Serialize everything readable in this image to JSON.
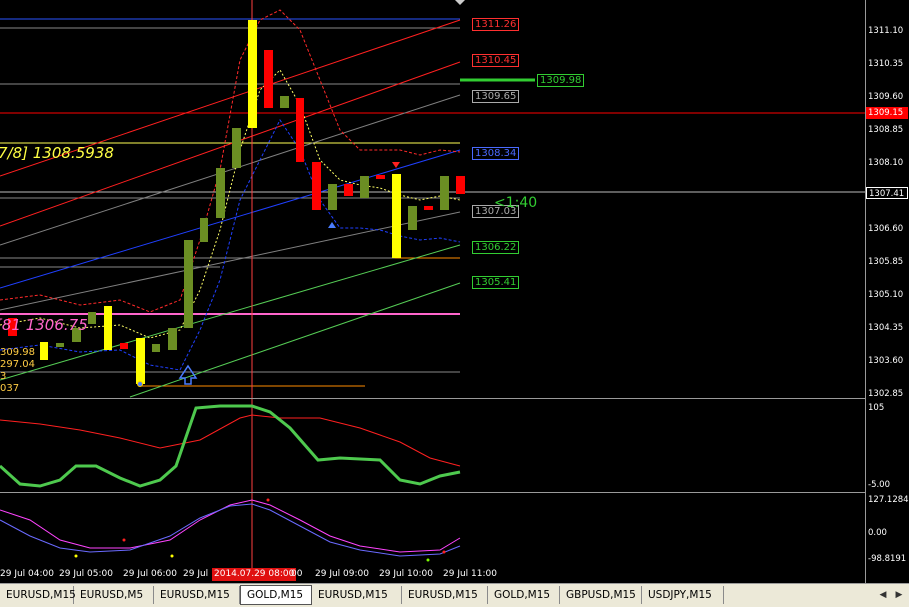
{
  "window": {
    "symbol": "GOLD",
    "timeframe": "M15"
  },
  "price_axis": {
    "labels": [
      "1311.10",
      "1310.35",
      "1309.60",
      "1308.85",
      "1308.10",
      "1307.35",
      "1306.60",
      "1305.85",
      "1305.10",
      "1304.35",
      "1303.60",
      "1302.85"
    ],
    "current_price": "1307.41",
    "highlight_price": "1309.15"
  },
  "price_tags": {
    "tag1": "1311.26",
    "tag2": "1310.45",
    "tag3": "1309.98",
    "tag4": "1309.65",
    "tag5": "1308.34",
    "tag6": "1307.03",
    "tag7": "1306.22",
    "tag8": "1305.41"
  },
  "overlays": {
    "murrey_label": "7/8]  1308.5938",
    "lower_label": "[81  1306.75",
    "countdown": "<1:40",
    "left_values": [
      "309.98",
      "297.04",
      "3",
      "037"
    ]
  },
  "indicator1": {
    "top_label": "105",
    "bottom_label": "-5.00"
  },
  "indicator2": {
    "top_label": "127.1284",
    "mid_label": "0.00",
    "bottom_label": "-98.8191"
  },
  "time_axis": {
    "labels": [
      "29 Jul 04:00",
      "29 Jul 05:00",
      "29 Jul 06:00",
      "29 Jul",
      "00",
      "29 Jul 09:00",
      "29 Jul 10:00",
      "29 Jul 11:00"
    ],
    "crosshair_time": "2014.07.29 08:00"
  },
  "tabs": [
    {
      "label": "EURUSD,M15",
      "active": false
    },
    {
      "label": "EURUSD,M5",
      "active": false
    },
    {
      "label": "EURUSD,M15",
      "active": false
    },
    {
      "label": "GOLD,M15",
      "active": true
    },
    {
      "label": "EURUSD,M15",
      "active": false
    },
    {
      "label": "EURUSD,M15",
      "active": false
    },
    {
      "label": "GOLD,M15",
      "active": false
    },
    {
      "label": "GBPUSD,M15",
      "active": false
    },
    {
      "label": "USDJPY,M15",
      "active": false
    }
  ],
  "colors": {
    "bull": "#6b8e23",
    "bear": "#ff0000",
    "highlight_bar": "#ffff00",
    "lime": "#7cfc00",
    "ma_red": "#ff2a2a",
    "ma_blue": "#1e3cff",
    "ma_green": "#32cd32",
    "magenta": "#ff66cc"
  }
}
